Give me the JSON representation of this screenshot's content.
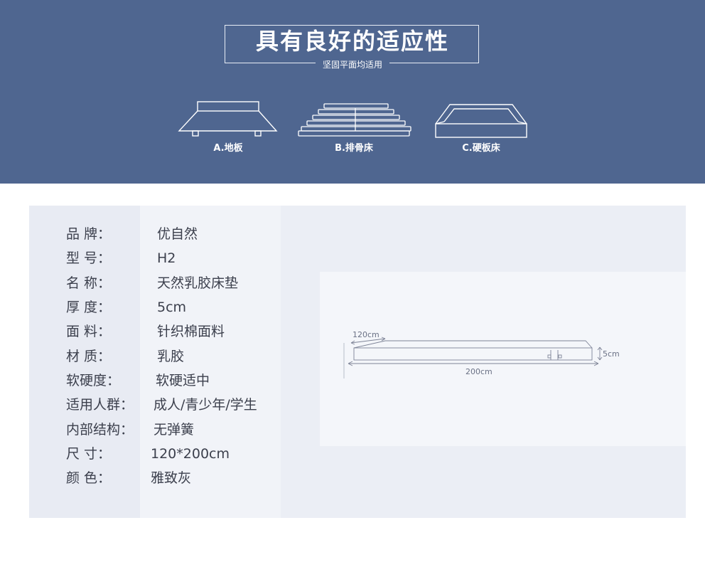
{
  "banner": {
    "title": "具有良好的适应性",
    "subtitle": "坚固平面均适用",
    "beds": [
      {
        "label": "A.地板",
        "icon": "floor-bed-icon"
      },
      {
        "label": "B.排骨床",
        "icon": "slatted-bed-icon"
      },
      {
        "label": "C.硬板床",
        "icon": "hard-board-bed-icon"
      }
    ]
  },
  "specs": [
    {
      "label": "品 牌：",
      "value": "优自然"
    },
    {
      "label": "型 号：",
      "value": "H2"
    },
    {
      "label": "名 称：",
      "value": "天然乳胶床垫"
    },
    {
      "label": "厚 度：",
      "value": "5cm"
    },
    {
      "label": "面 料：",
      "value": "针织棉面料"
    },
    {
      "label": "材 质：",
      "value": "乳胶"
    },
    {
      "label": "软硬度：",
      "value": "软硬适中"
    },
    {
      "label": "适用人群：",
      "value": "成人/青少年/学生"
    },
    {
      "label": "内部结构：",
      "value": "无弹簧"
    },
    {
      "label": "尺 寸：",
      "value": "120*200cm"
    },
    {
      "label": "颜 色：",
      "value": "雅致灰"
    }
  ],
  "diagram": {
    "width_label": "120cm",
    "length_label": "200cm",
    "thickness_label": "5cm"
  },
  "colors": {
    "banner": "#4f6690",
    "card": "#e8ebf3",
    "text": "#3b3f4c"
  }
}
